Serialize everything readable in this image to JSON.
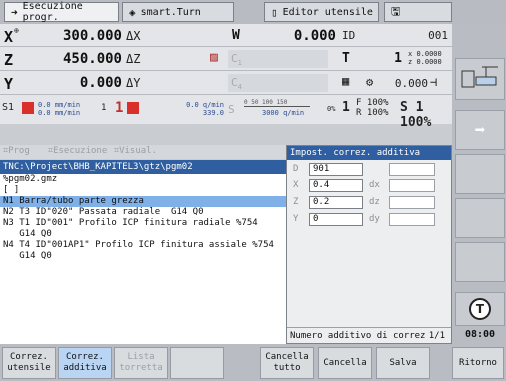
{
  "tabs": [
    {
      "label": "Esecuzione progr.",
      "icon": "arrow-right-icon"
    },
    {
      "label": "smart.Turn",
      "icon": "diamond-arrows-icon"
    },
    {
      "label": "Editor utensile",
      "icon": "tool-holder-icon"
    },
    {
      "label": "",
      "icon": "save-disk-icon"
    }
  ],
  "axes": {
    "x": {
      "name": "X",
      "value": "300.000",
      "delta": "ΔX"
    },
    "z": {
      "name": "Z",
      "value": "450.000",
      "delta": "ΔZ"
    },
    "y": {
      "name": "Y",
      "value": "0.000",
      "delta": "ΔY"
    }
  },
  "w": {
    "name": "W",
    "value": "0.000",
    "id_label": "ID",
    "id_value": "001"
  },
  "c1": {
    "label": "C",
    "sub": "1"
  },
  "c4": {
    "label": "C",
    "sub": "4"
  },
  "t": {
    "label": "T",
    "num": "1",
    "x_off": "0.0000",
    "z_off": "0.0000"
  },
  "spindle_val": "0.000",
  "feedrow": {
    "s_label": "S1",
    "mmmin_1": "0.0 mm/min",
    "mmmin_2": "0.0 mm/min",
    "num_a": "1",
    "num_b": "1",
    "qmin": "0.0 q/min",
    "qval": "339.0",
    "s1_small": "1",
    "scale_vals": "0  50  100  150",
    "rpm": "3000 q/min",
    "pct_label": "0%",
    "f_pct": "F 100%",
    "r_pct": "R 100%",
    "s_pct": "S 1 100%"
  },
  "prog_tabs": [
    "Prog",
    "Esecuzione",
    "Visual."
  ],
  "path": "TNC:\\Project\\BHB_KAPITEL3\\gtz\\pgm02",
  "program_lines": [
    "%pgm02.gmz",
    "[ ]",
    "N1 Barra/tubo parte grezza",
    "N2 T3 ID\"020\" Passata radiale  G14 Q0",
    "N3 T1 ID\"001\" Profilo ICP finitura radiale %754",
    "   G14 Q0",
    "N4 T4 ID\"001AP1\" Profilo ICP finitura assiale %754",
    "   G14 Q0"
  ],
  "dialog": {
    "title": "Impost. correz. additiva",
    "d_label": "D",
    "d_value": "901",
    "x_label": "X",
    "x_value": "0.4",
    "dx_label": "dx",
    "z_label": "Z",
    "z_value": "0.2",
    "dz_label": "dz",
    "y_label": "Y",
    "y_value": "0",
    "dy_label": "dy",
    "footer": "Numero additivo di correz",
    "page": "1/1"
  },
  "clock": "08:00",
  "softkeys": [
    {
      "label": "Correz.\nutensile",
      "state": "normal"
    },
    {
      "label": "Correz.\nadditiva",
      "state": "active"
    },
    {
      "label": "Lista\ntorretta",
      "state": "disabled"
    },
    {
      "label": "",
      "state": "normal"
    },
    {
      "label": "Cancella\ntutto",
      "state": "normal"
    },
    {
      "label": "Cancella",
      "state": "normal"
    },
    {
      "label": "Salva",
      "state": "normal"
    },
    {
      "label": "Ritorno",
      "state": "normal"
    }
  ]
}
